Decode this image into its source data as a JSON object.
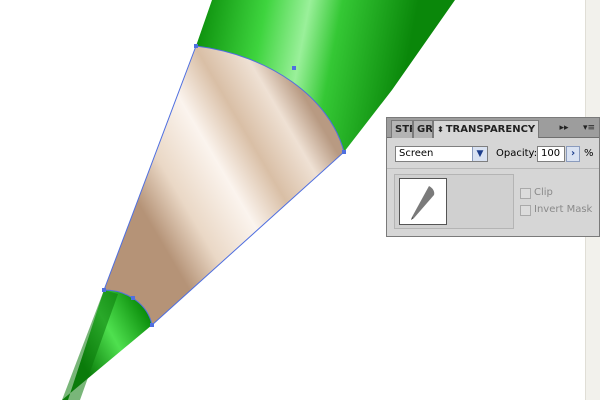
{
  "panel": {
    "tabs": [
      {
        "label": "STR",
        "active": false
      },
      {
        "label": "GRA",
        "active": false
      },
      {
        "label": "TRANSPARENCY",
        "active": true
      }
    ],
    "blend_mode": "Screen",
    "opacity_label": "Opacity:",
    "opacity_value": "100",
    "percent_sign": "%",
    "clip_label": "Clip",
    "invert_mask_label": "Invert Mask",
    "clip_checked": false,
    "invert_mask_checked": false,
    "icons": {
      "collapse": "double-triangle-right-icon",
      "menu": "panel-menu-icon",
      "select_arrow": "chevron-down-icon",
      "stepper": "chevron-right-icon"
    }
  },
  "artwork": {
    "pencil_body_color": "#1fb51f",
    "wood_color": "#e2c9b2",
    "lead_color": "#14a614",
    "anchor_color": "#3b5bdb"
  }
}
